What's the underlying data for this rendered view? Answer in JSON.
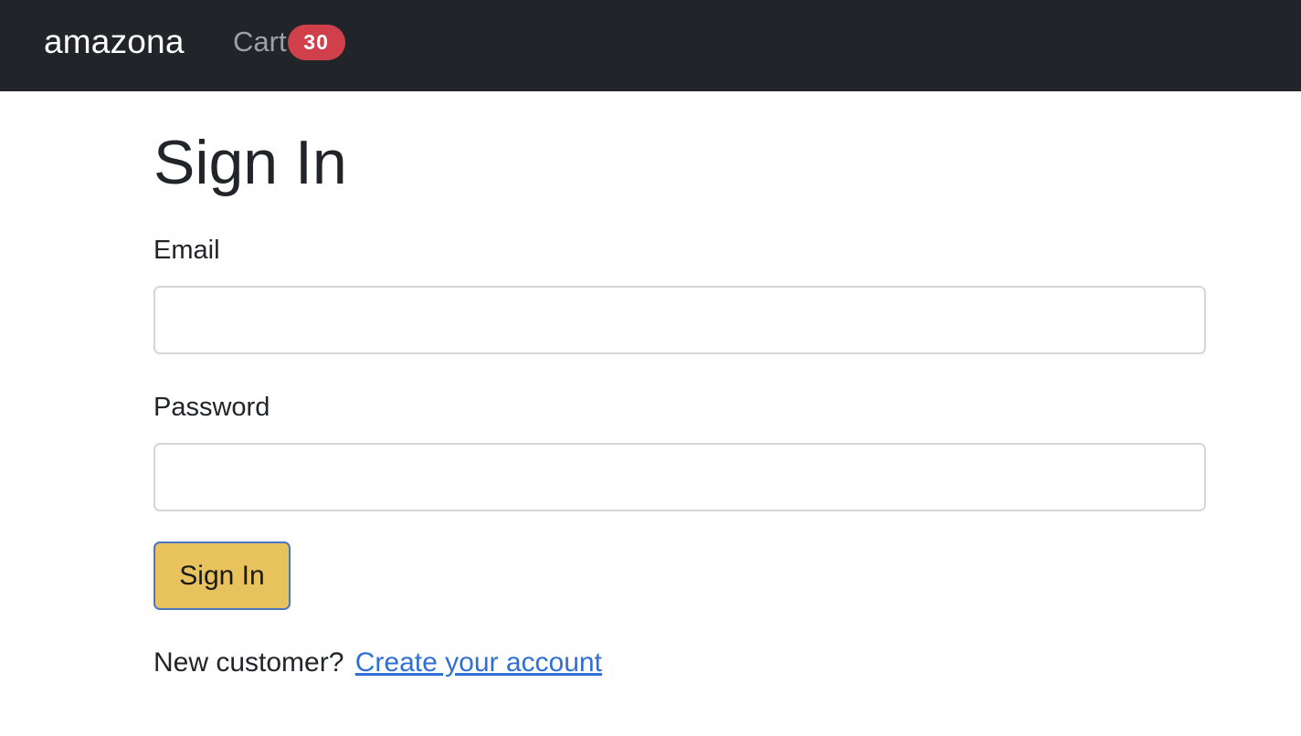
{
  "navbar": {
    "brand": "amazona",
    "cart_label": "Cart",
    "cart_count": "30",
    "background_color": "#212529",
    "badge_color": "#d0404b"
  },
  "main": {
    "title": "Sign In",
    "email_label": "Email",
    "email_value": "",
    "password_label": "Password",
    "password_value": "",
    "submit_label": "Sign In",
    "submit_color": "#e8c25c",
    "new_customer_text": "New customer?",
    "create_account_link": "Create your account",
    "link_color": "#2f6fd6"
  }
}
